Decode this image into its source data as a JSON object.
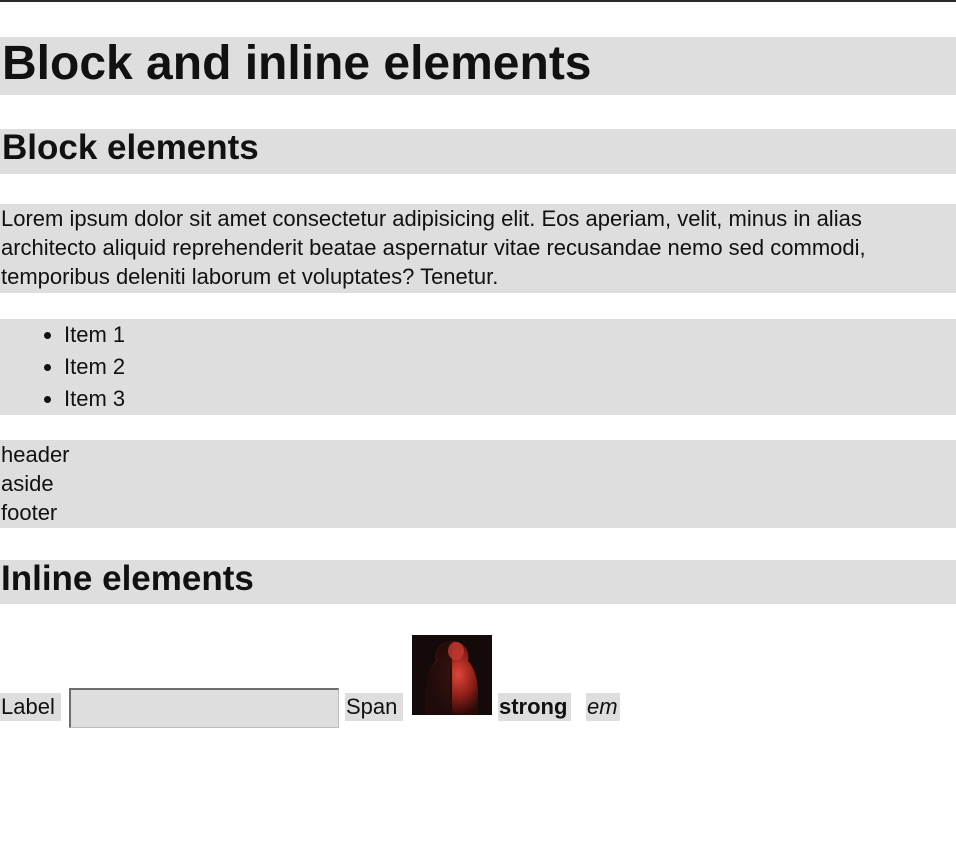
{
  "headings": {
    "main": "Block and inline elements",
    "block_section": "Block elements",
    "inline_section": "Inline elements"
  },
  "paragraph": "Lorem ipsum dolor sit amet consectetur adipisicing elit. Eos aperiam, velit, minus in alias architecto aliquid reprehenderit beatae aspernatur vitae recusandae nemo sed commodi, temporibus deleniti laborum et voluptates? Tenetur.",
  "list_items": [
    "Item 1",
    "Item 2",
    "Item 3"
  ],
  "semantic_blocks": [
    "header",
    "aside",
    "footer"
  ],
  "inline": {
    "label": "Label",
    "input_value": "",
    "span": "Span",
    "strong": "strong",
    "em": "em"
  },
  "colors": {
    "element_background": "#dedede",
    "text": "#111111",
    "top_border": "#2a2a2a"
  }
}
